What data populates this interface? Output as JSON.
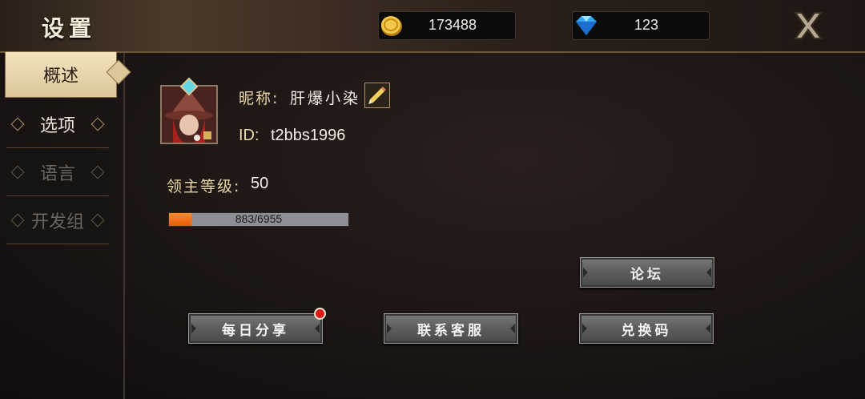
{
  "header": {
    "title": "设置",
    "gold": "173488",
    "diamonds": "123"
  },
  "sidebar": {
    "items": [
      {
        "label": "概述"
      },
      {
        "label": "选项"
      },
      {
        "label": "语言"
      },
      {
        "label": "开发组"
      }
    ]
  },
  "profile": {
    "nickname_label": "昵称:",
    "nickname": "肝爆小染",
    "id_label": "ID:",
    "id": "t2bbs1996",
    "level_label": "领主等级:",
    "level": "50",
    "xp_text": "883/6955",
    "xp_fraction": 0.127
  },
  "buttons": {
    "forum": "论坛",
    "daily_share": "每日分享",
    "customer_service": "联系客服",
    "redeem_code": "兑换码"
  },
  "colors": {
    "accent_gold": "#e9d7a6",
    "xp_fill": "#f07020",
    "notification": "#e01818"
  }
}
